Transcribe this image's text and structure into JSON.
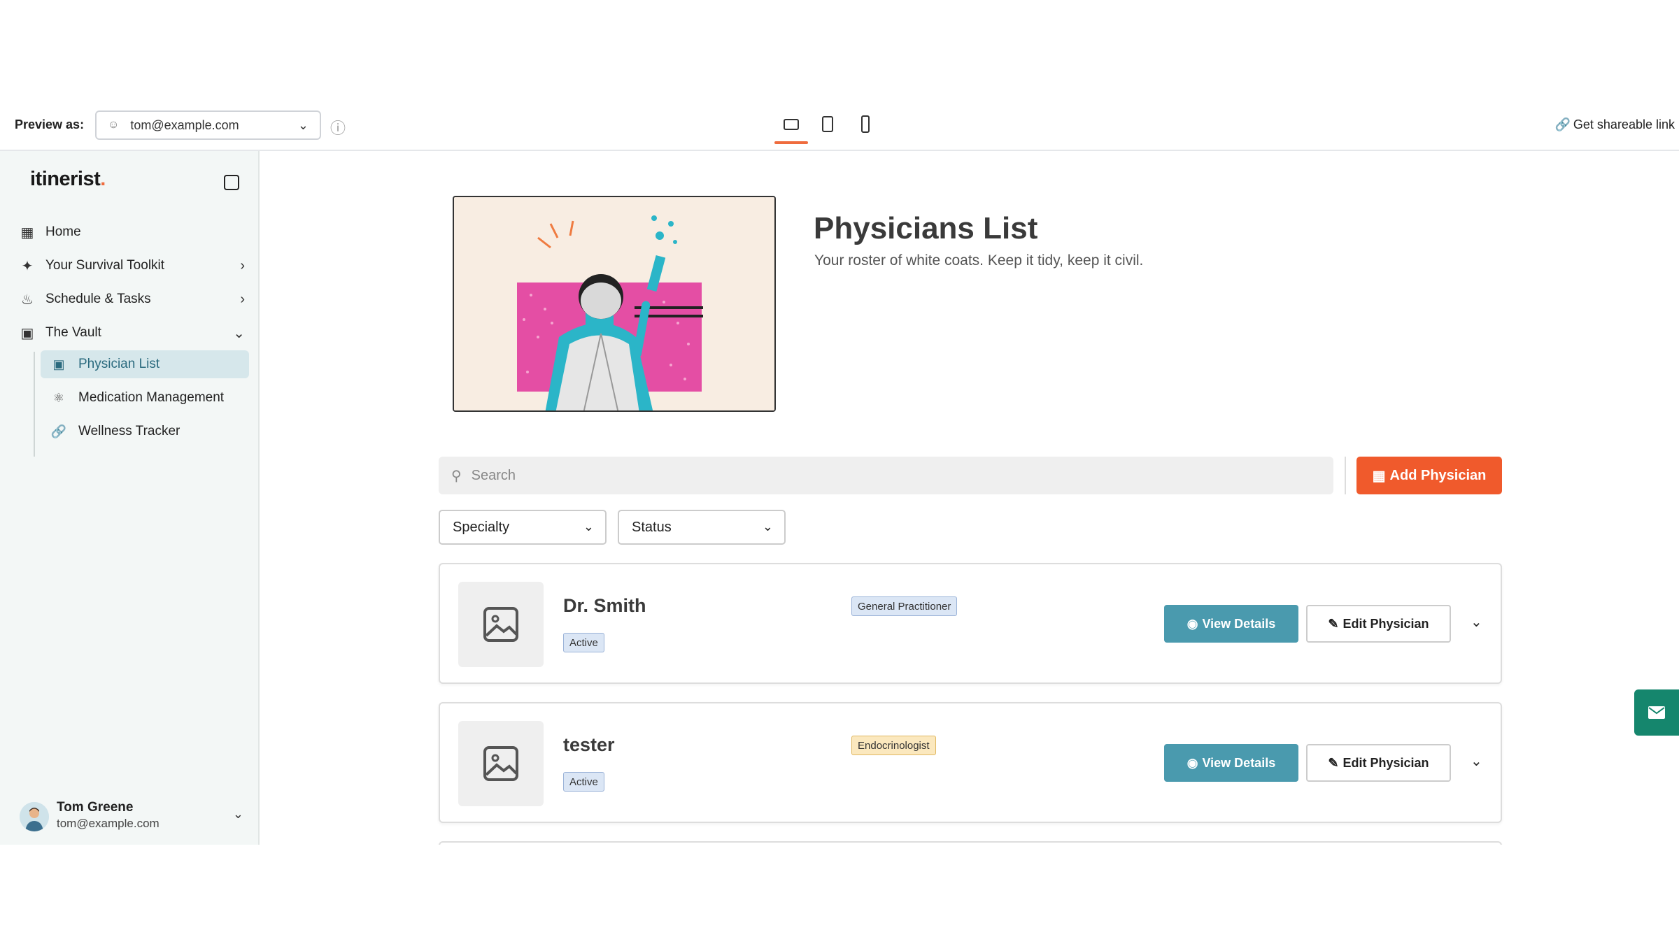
{
  "topbar": {
    "preview_label": "Preview as:",
    "preview_user": "tom@example.com",
    "share_label": "Get shareable link"
  },
  "sidebar": {
    "logo_text": "itinerist",
    "logo_dot": ".",
    "items": [
      {
        "label": "Home",
        "icon": "grid-icon"
      },
      {
        "label": "Your Survival Toolkit",
        "icon": "sparkle-icon"
      },
      {
        "label": "Schedule & Tasks",
        "icon": "steam-icon"
      },
      {
        "label": "The Vault",
        "icon": "vault-icon"
      }
    ],
    "vault_items": [
      {
        "label": "Physician List",
        "icon": "list-icon",
        "active": true
      },
      {
        "label": "Medication Management",
        "icon": "atom-icon"
      },
      {
        "label": "Wellness Tracker",
        "icon": "link-icon"
      }
    ],
    "user": {
      "name": "Tom Greene",
      "email": "tom@example.com"
    }
  },
  "main": {
    "title": "Physicians List",
    "subtitle": "Your roster of white coats. Keep it tidy, keep it civil.",
    "search_placeholder": "Search",
    "add_button": "Add Physician",
    "filters": {
      "specialty": "Specialty",
      "status": "Status"
    },
    "physicians": [
      {
        "name": "Dr. Smith",
        "status": "Active",
        "specialty": "General Practitioner",
        "specialty_color": "#dbe6f5"
      },
      {
        "name": "tester",
        "status": "Active",
        "specialty": "Endocrinologist",
        "specialty_color": "#fbe8be"
      }
    ],
    "view_label": "View Details",
    "edit_label": "Edit Physician"
  },
  "colors": {
    "accent": "#f05a2c",
    "teal": "#4a9aae",
    "fab": "#15866d",
    "active_nav": "#d6e7eb"
  }
}
